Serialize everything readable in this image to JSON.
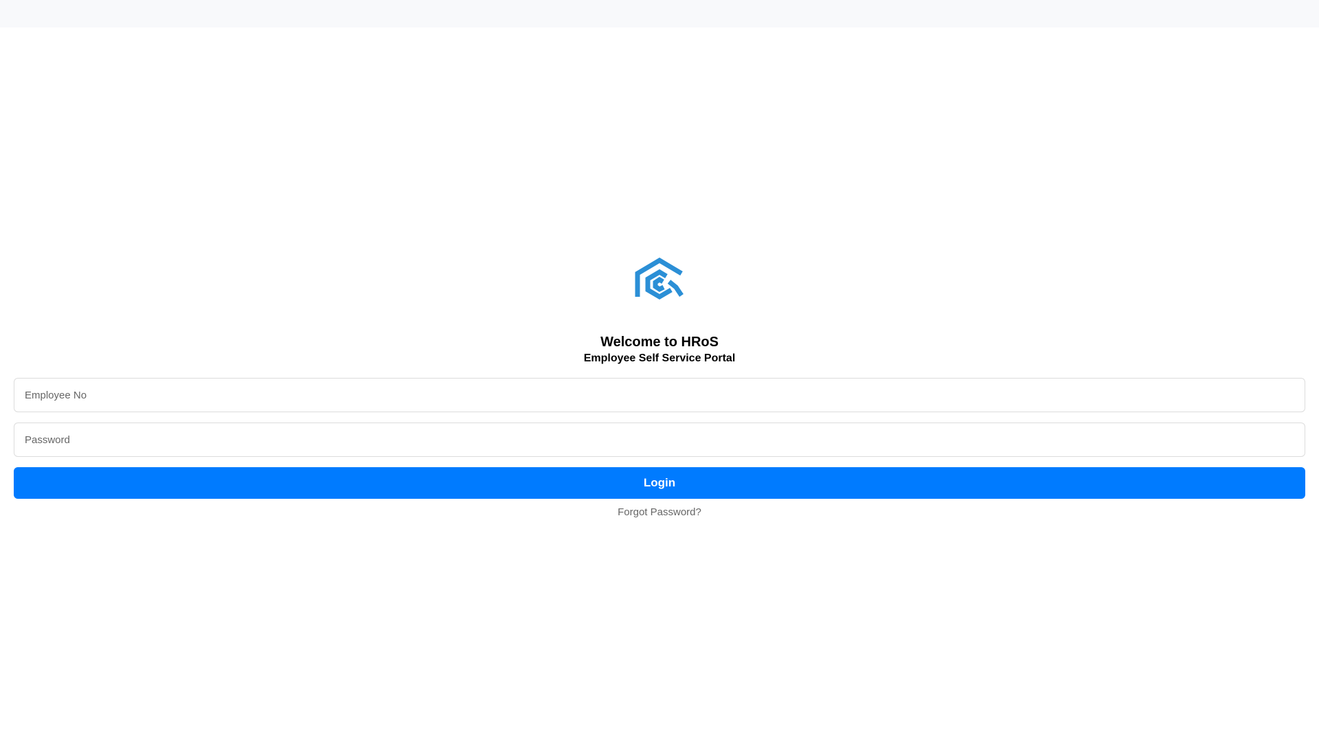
{
  "logo": {
    "icon": "hros-logo-icon",
    "color": "#2b8fd6"
  },
  "header": {
    "title": "Welcome to HRoS",
    "subtitle": "Employee Self Service Portal"
  },
  "form": {
    "employee_no": {
      "placeholder": "Employee No",
      "value": ""
    },
    "password": {
      "placeholder": "Password",
      "value": ""
    },
    "login_label": "Login",
    "forgot_label": "Forgot Password?"
  },
  "colors": {
    "primary": "#007bff",
    "top_bar": "#f8f9fb",
    "muted_text": "#666666"
  }
}
